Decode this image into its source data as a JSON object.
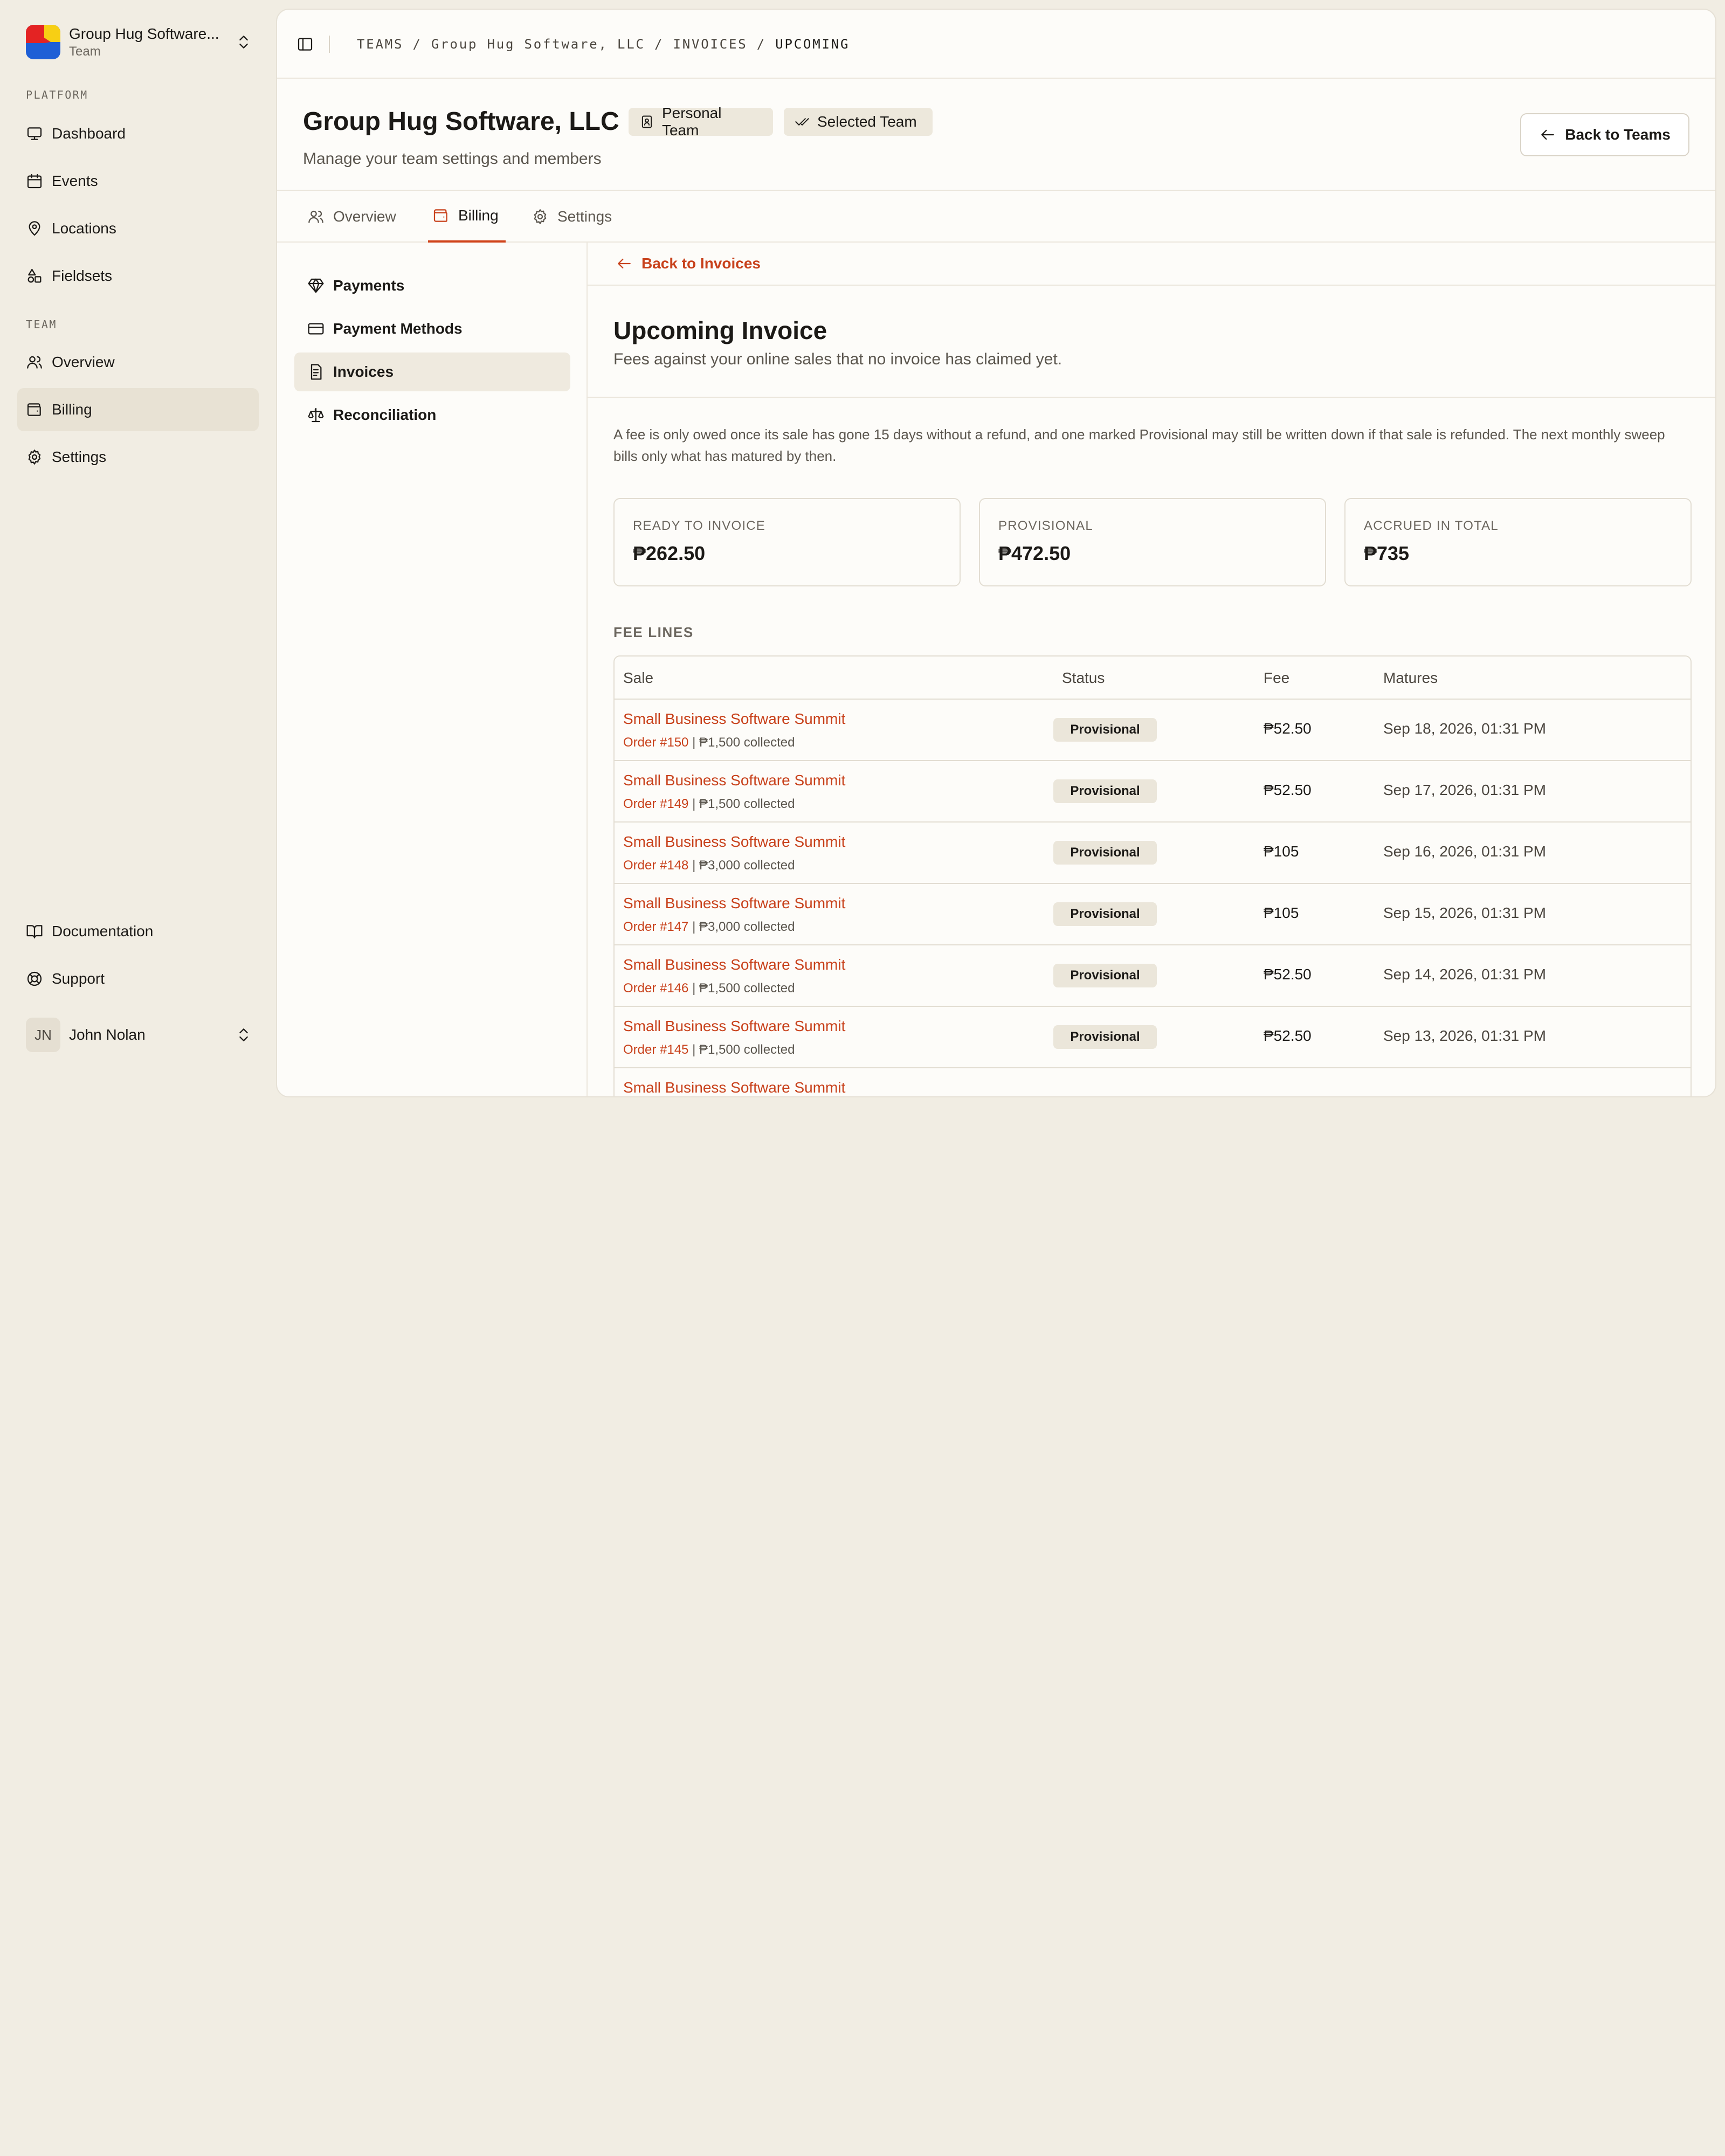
{
  "team_switcher": {
    "name": "Group Hug Software...",
    "subtitle": "Team"
  },
  "sidebar": {
    "platform_label": "PLATFORM",
    "team_label": "TEAM",
    "platform_items": [
      {
        "label": "Dashboard",
        "icon": "monitor-icon"
      },
      {
        "label": "Events",
        "icon": "calendar-icon"
      },
      {
        "label": "Locations",
        "icon": "map-pin-icon"
      },
      {
        "label": "Fieldsets",
        "icon": "shapes-icon"
      }
    ],
    "team_items": [
      {
        "label": "Overview",
        "icon": "users-icon"
      },
      {
        "label": "Billing",
        "icon": "wallet-icon",
        "active": true
      },
      {
        "label": "Settings",
        "icon": "gear-icon"
      }
    ],
    "footer_items": [
      {
        "label": "Documentation",
        "icon": "book-icon"
      },
      {
        "label": "Support",
        "icon": "lifebuoy-icon"
      }
    ],
    "user": {
      "initials": "JN",
      "name": "John Nolan"
    }
  },
  "breadcrumb": {
    "text": "TEAMS / Group Hug Software, LLC / INVOICES / ",
    "current": "UPCOMING"
  },
  "header": {
    "title": "Group Hug Software, LLC",
    "badge_personal": "Personal Team",
    "badge_selected": "Selected Team",
    "subtitle": "Manage your team settings and members",
    "back_button": "Back to Teams"
  },
  "tabs": [
    {
      "label": "Overview"
    },
    {
      "label": "Billing",
      "active": true
    },
    {
      "label": "Settings"
    }
  ],
  "billing_nav": [
    {
      "label": "Payments"
    },
    {
      "label": "Payment Methods"
    },
    {
      "label": "Invoices",
      "active": true
    },
    {
      "label": "Reconciliation"
    }
  ],
  "invoice": {
    "back_link": "Back to Invoices",
    "title": "Upcoming Invoice",
    "subtitle": "Fees against your online sales that no invoice has claimed yet.",
    "notice": "A fee is only owed once its sale has gone 15 days without a refund, and one marked Provisional may still be written down if that sale is refunded. The next monthly sweep bills only what has matured by then.",
    "stats": [
      {
        "label": "READY TO INVOICE",
        "value": "₱262.50"
      },
      {
        "label": "PROVISIONAL",
        "value": "₱472.50"
      },
      {
        "label": "ACCRUED IN TOTAL",
        "value": "₱735"
      }
    ],
    "fee_lines_label": "FEE LINES",
    "columns": {
      "sale": "Sale",
      "status": "Status",
      "fee": "Fee",
      "matures": "Matures"
    },
    "rows": [
      {
        "sale": "Small Business Software Summit",
        "order": "Order #150",
        "collected": " | ₱1,500 collected",
        "status": "Provisional",
        "fee": "₱52.50",
        "matures": "Sep 18, 2026, 01:31 PM"
      },
      {
        "sale": "Small Business Software Summit",
        "order": "Order #149",
        "collected": " | ₱1,500 collected",
        "status": "Provisional",
        "fee": "₱52.50",
        "matures": "Sep 17, 2026, 01:31 PM"
      },
      {
        "sale": "Small Business Software Summit",
        "order": "Order #148",
        "collected": " | ₱3,000 collected",
        "status": "Provisional",
        "fee": "₱105",
        "matures": "Sep 16, 2026, 01:31 PM"
      },
      {
        "sale": "Small Business Software Summit",
        "order": "Order #147",
        "collected": " | ₱3,000 collected",
        "status": "Provisional",
        "fee": "₱105",
        "matures": "Sep 15, 2026, 01:31 PM"
      },
      {
        "sale": "Small Business Software Summit",
        "order": "Order #146",
        "collected": " | ₱1,500 collected",
        "status": "Provisional",
        "fee": "₱52.50",
        "matures": "Sep 14, 2026, 01:31 PM"
      },
      {
        "sale": "Small Business Software Summit",
        "order": "Order #145",
        "collected": " | ₱1,500 collected",
        "status": "Provisional",
        "fee": "₱52.50",
        "matures": "Sep 13, 2026, 01:31 PM"
      },
      {
        "sale": "Small Business Software Summit",
        "order": "",
        "collected": "",
        "status": "",
        "fee": "",
        "matures": ""
      }
    ]
  },
  "colors": {
    "accent": "#c8411b",
    "sidebar_bg": "#f1ede3",
    "panel_bg": "#fdfcf9"
  }
}
